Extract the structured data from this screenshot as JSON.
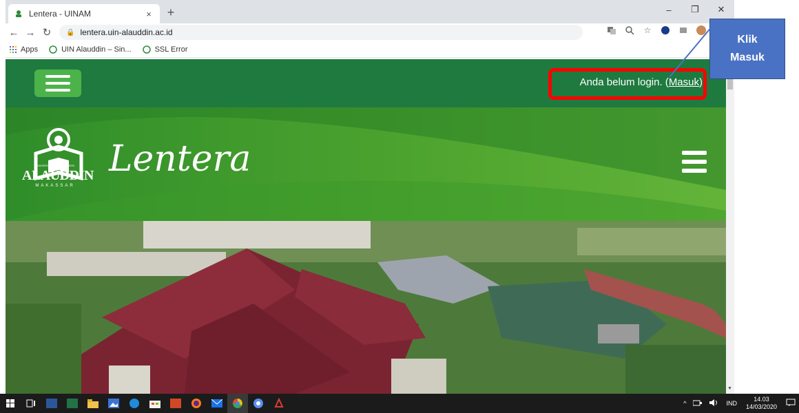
{
  "browser": {
    "tab_title": "Lentera - UINAM",
    "tab_close": "×",
    "new_tab": "+",
    "window": {
      "minimize": "–",
      "restore": "❐",
      "close": "✕"
    },
    "url": "lentera.uin-alauddin.ac.id",
    "bookmarks": [
      {
        "label": "Apps"
      },
      {
        "label": "UIN Alauddin – Sin..."
      },
      {
        "label": "SSL Error"
      }
    ]
  },
  "page": {
    "login_prefix": "Anda belum login. (",
    "login_link": "Masuk",
    "login_suffix": ")",
    "brand": "Lentera",
    "logo": {
      "name": "ALAUDDIN",
      "subtitle": "UNIVERSITAS ISLAM NEGERI",
      "city": "MAKASSAR"
    }
  },
  "annotation": {
    "line1": "Klik",
    "line2": "Masuk",
    "highlight_color": "#ff0000",
    "callout_color": "#4a72c4"
  },
  "colors": {
    "navbar": "#1f7a3f",
    "hamburger_button": "#4bb34a",
    "hero": "#4ca32e"
  },
  "taskbar": {
    "tray_language": "IND",
    "time": "14.03",
    "date": "14/03/2020"
  }
}
